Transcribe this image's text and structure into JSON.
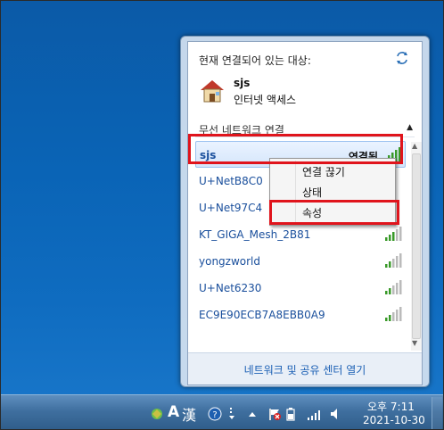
{
  "popup": {
    "current_label": "현재 연결되어 있는 대상:",
    "connected": {
      "name": "sjs",
      "status": "인터넷 액세스"
    },
    "section_title": "무선 네트워크 연결",
    "networks": [
      {
        "name": "sjs",
        "state": "연결됨",
        "selected": true
      },
      {
        "name": "U+NetB8C0"
      },
      {
        "name": "U+Net97C4"
      },
      {
        "name": "KT_GIGA_Mesh_2B81"
      },
      {
        "name": "yongzworld"
      },
      {
        "name": "U+Net6230"
      },
      {
        "name": "EC9E90ECB7A8EBB0A9"
      }
    ],
    "footer_link": "네트워크 및 공유 센터 열기"
  },
  "context_menu": {
    "items": [
      "연결 끊기",
      "상태",
      "속성"
    ]
  },
  "taskbar": {
    "ime_label": "A",
    "hanja_label": "漢",
    "time": "오후 7:11",
    "date": "2021-10-30"
  },
  "colors": {
    "highlight_red": "#e0141c",
    "link_blue": "#1a4f9c",
    "desktop_blue": "#0b5aa7"
  },
  "icons": [
    "refresh-icon",
    "house-icon",
    "signal-icon",
    "help-icon",
    "flag-icon",
    "battery-icon",
    "speaker-icon"
  ]
}
